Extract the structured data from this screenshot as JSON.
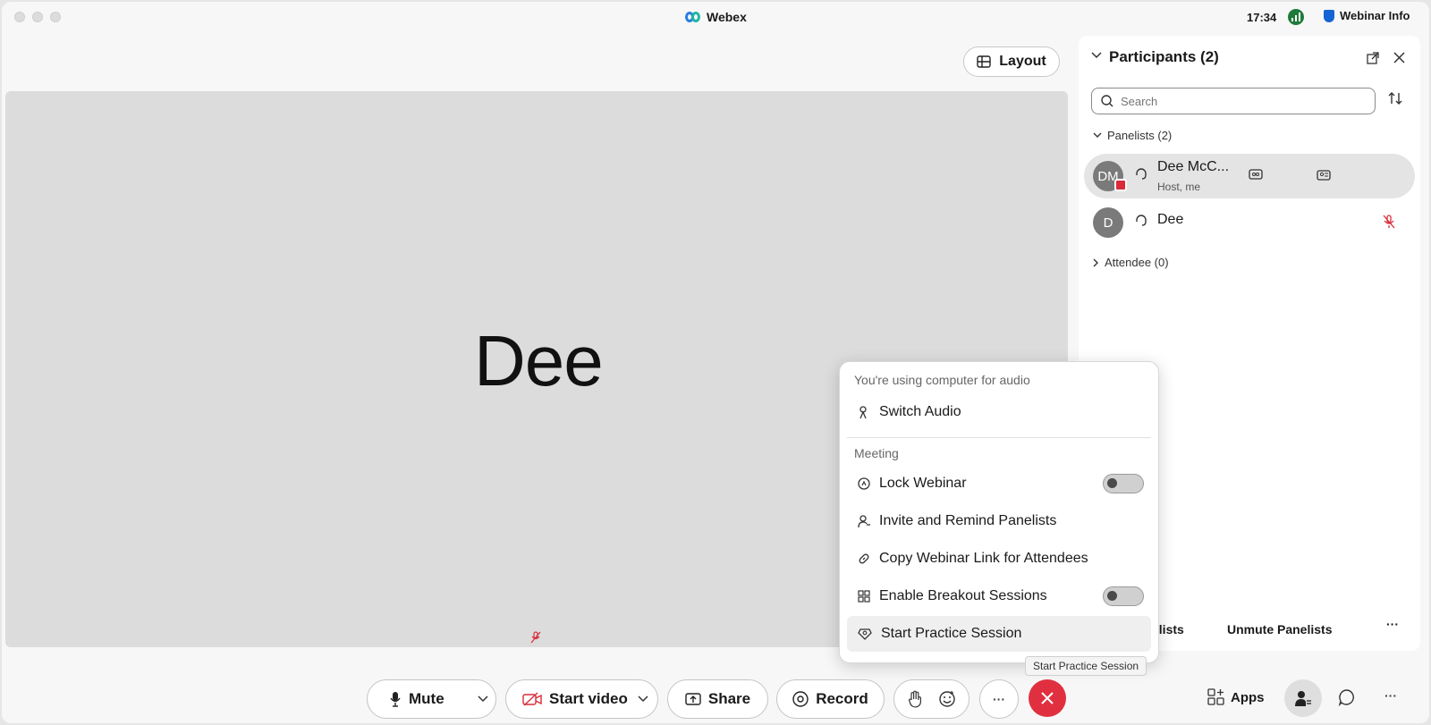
{
  "app": {
    "title": "Webex",
    "clock": "17:34",
    "webinar_info": "Webinar Info"
  },
  "layout_button": "Layout",
  "stage": {
    "name": "Dee"
  },
  "participants": {
    "title": "Participants (2)",
    "search_placeholder": "Search",
    "panelists_group": "Panelists (2)",
    "attendee_group": "Attendee (0)",
    "people": [
      {
        "initials": "DM",
        "name": "Dee McC...",
        "subtitle": "Host, me"
      },
      {
        "initials": "D",
        "name": "Dee",
        "subtitle": ""
      }
    ],
    "footer": {
      "left": "elists",
      "unmute": "Unmute Panelists",
      "more": "···"
    }
  },
  "menu": {
    "audio_header": "You're using computer for audio",
    "switch_audio": "Switch Audio",
    "meeting_header": "Meeting",
    "lock_webinar": "Lock Webinar",
    "invite_panelists": "Invite and Remind Panelists",
    "copy_link": "Copy Webinar Link for Attendees",
    "breakout": "Enable Breakout Sessions",
    "practice": "Start Practice Session",
    "lock_on": false,
    "breakout_on": false
  },
  "tooltip": "Start Practice Session",
  "toolbar": {
    "mute": "Mute",
    "start_video": "Start video",
    "share": "Share",
    "record": "Record",
    "more": "···",
    "apps": "Apps",
    "right_more": "···"
  },
  "colors": {
    "accent_red": "#e0303f",
    "host_badge": "#d92b3a",
    "muted_red": "#d92b3a",
    "signal_green": "#1f7a3a",
    "shield_blue": "#1663d6"
  }
}
